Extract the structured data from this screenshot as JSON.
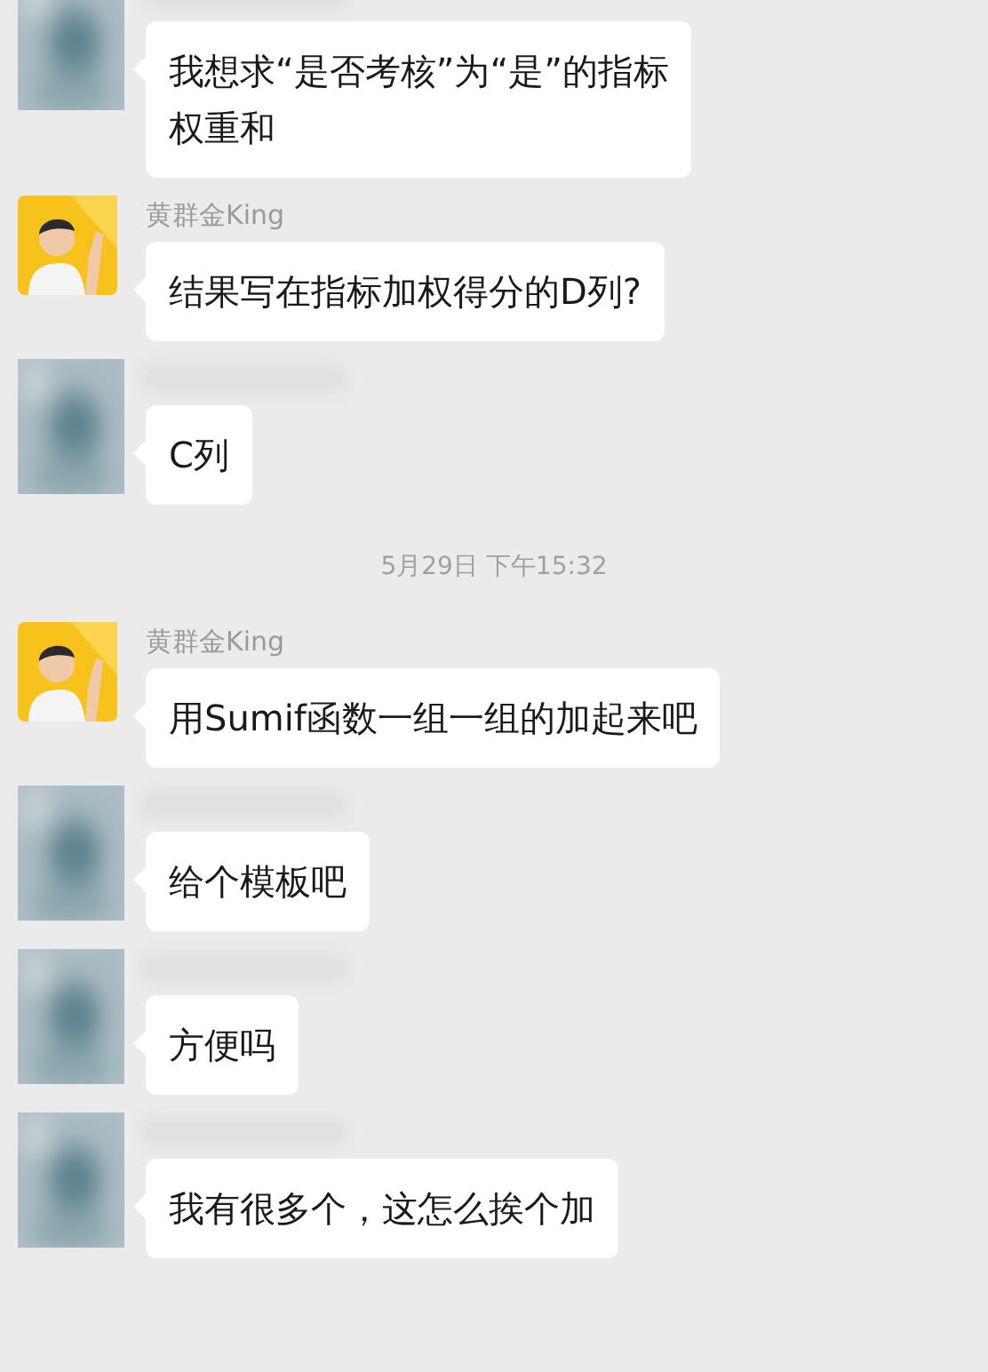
{
  "messages": [
    {
      "kind": "message",
      "avatar": {
        "kind": "picture"
      },
      "lines": [
        "我想求“是否考核”为“是”的指标",
        "权重和"
      ]
    },
    {
      "kind": "message",
      "avatar": {
        "kind": "figure"
      },
      "sender": "黄群金King",
      "lines": [
        "结果写在指标加权得分的D列?"
      ]
    },
    {
      "kind": "message",
      "avatar": {
        "kind": "picture"
      },
      "lines": [
        "C列"
      ]
    },
    {
      "kind": "time",
      "text": "5月29日 下午15:32"
    },
    {
      "kind": "message",
      "avatar": {
        "kind": "figure"
      },
      "sender": "黄群金King",
      "lines": [
        "用Sumif函数一组一组的加起来吧"
      ]
    },
    {
      "kind": "message",
      "avatar": {
        "kind": "picture"
      },
      "lines": [
        "给个模板吧"
      ]
    },
    {
      "kind": "message",
      "avatar": {
        "kind": "picture"
      },
      "lines": [
        "方便吗"
      ]
    },
    {
      "kind": "message",
      "avatar": {
        "kind": "picture"
      },
      "lines": [
        "我有很多个，这怎么挨个加"
      ]
    }
  ]
}
